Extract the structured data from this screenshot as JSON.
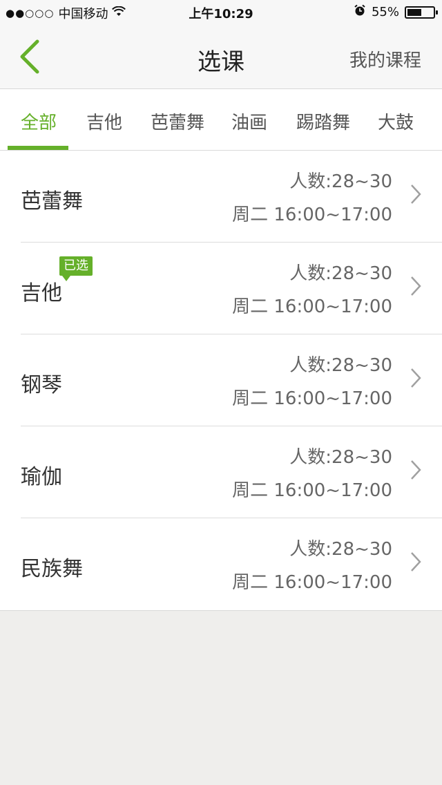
{
  "status": {
    "signal": "●●○○○",
    "carrier": "中国移动",
    "wifi_icon": "wifi-icon",
    "time": "上午10:29",
    "alarm_icon": "alarm-icon",
    "battery_text": "55%",
    "battery_level": 0.55
  },
  "nav": {
    "title": "选课",
    "right_label": "我的课程",
    "back_icon": "chevron-left-icon"
  },
  "tabs": [
    {
      "label": "全部"
    },
    {
      "label": "吉他"
    },
    {
      "label": "芭蕾舞"
    },
    {
      "label": "油画"
    },
    {
      "label": "踢踏舞"
    },
    {
      "label": "大鼓"
    }
  ],
  "colors": {
    "accent": "#65b02a"
  },
  "courses": [
    {
      "name": "芭蕾舞",
      "count": "人数:28~30",
      "time": "周二 16:00~17:00",
      "badge": ""
    },
    {
      "name": "吉他",
      "count": "人数:28~30",
      "time": "周二 16:00~17:00",
      "badge": "已选"
    },
    {
      "name": "钢琴",
      "count": "人数:28~30",
      "time": "周二 16:00~17:00",
      "badge": ""
    },
    {
      "name": "瑜伽",
      "count": "人数:28~30",
      "time": "周二 16:00~17:00",
      "badge": ""
    },
    {
      "name": "民族舞",
      "count": "人数:28~30",
      "time": "周二 16:00~17:00",
      "badge": ""
    }
  ]
}
